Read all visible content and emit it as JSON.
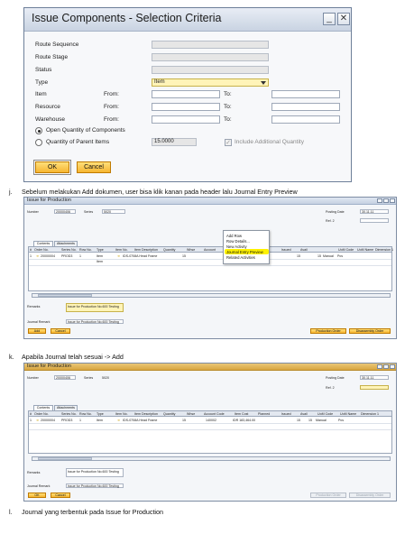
{
  "dialog": {
    "title": "Issue Components - Selection Criteria",
    "rows": [
      {
        "label": "Route Sequence",
        "value": ""
      },
      {
        "label": "Route Stage",
        "value": ""
      },
      {
        "label": "Status",
        "value": ""
      },
      {
        "label": "Type",
        "value": "Item"
      },
      {
        "label": "Item",
        "from": "From:",
        "to": "To:"
      },
      {
        "label": "Resource",
        "from": "From:",
        "to": "To:"
      },
      {
        "label": "Warehouse",
        "from": "From:",
        "to": "To:"
      }
    ],
    "radio_open": "Open Quantity of Components",
    "radio_parent": "Quantity of Parent Items",
    "parent_qty": "15.0000",
    "include_additional": "Include Additional Quantity",
    "ok": "OK",
    "cancel": "Cancel"
  },
  "captions": [
    {
      "num": "j.",
      "text": "Sebelum melakukan Add dokumen, user bisa klik kanan pada header lalu Journal Entry Preview"
    },
    {
      "num": "k.",
      "text": "Apabila Journal telah sesuai -> Add"
    },
    {
      "num": "l.",
      "text": "Journal yang terbentuk pada Issue for Production"
    }
  ],
  "win1": {
    "title": "Issue for Production",
    "number_label": "Number",
    "number": "20000406",
    "series_label": "Series",
    "series": "5020",
    "posting_label": "Posting Date",
    "posting": "30.11.11",
    "ref_label": "Ref. 2",
    "tabs": [
      "Contents",
      "Attachments"
    ],
    "headers": [
      "#",
      "Order No.",
      "Series No.",
      "Row No.",
      "Type",
      "Item No.",
      "Item Description",
      "Quantity",
      "Whse",
      "Account",
      "",
      "Issued",
      "Avail",
      "UoM Code",
      "UoM Name",
      "Dimension 1"
    ],
    "row1": [
      "1",
      "20000004",
      "PROD3",
      "1",
      "Item",
      "",
      "IDS-0708A Head Frame",
      "",
      "",
      "15",
      "",
      "",
      "15",
      "15",
      "Manual",
      "Pcs"
    ],
    "row2": [
      "Item"
    ],
    "context_menu": [
      "Add Row",
      "Row Details...",
      "New Activity",
      "Journal Entry Preview",
      "Related Activities"
    ],
    "remarks_label": "Remarks",
    "remarks": "Issue for Production No.600 Testing",
    "journal_label": "Journal Remark",
    "journal": "Issue for Production No.600 Testing",
    "btn_add": "Add",
    "btn_cancel": "Cancel",
    "btn_po": "Production Order",
    "btn_do": "Disassembly Order"
  },
  "win2": {
    "title": "Issue for Production",
    "number_label": "Number",
    "number": "20000406",
    "series_label": "Series",
    "series": "5020",
    "posting_label": "Posting Date",
    "posting": "30.11.11",
    "ref_label": "Ref. 2",
    "tabs": [
      "Contents",
      "Attachments"
    ],
    "headers": [
      "#",
      "Order No.",
      "Series No.",
      "Row No.",
      "Type",
      "Item No.",
      "Item Description",
      "Quantity",
      "Whse",
      "Account Code",
      "Item Cost",
      "Planned",
      "Issued",
      "Avail",
      "UoM Code",
      "UoM Name",
      "Dimension 1"
    ],
    "row1": [
      "1",
      "20000004",
      "PROD3",
      "1",
      "Item",
      "",
      "IDS-0708A Head Frame",
      "",
      "",
      "15",
      "",
      "",
      "140002",
      "IDR 183,464.00",
      "15",
      "15",
      "Manual",
      "Pcs"
    ],
    "remarks_label": "Remarks",
    "remarks": "Issue for Production No.600 Testing",
    "journal_label": "Journal Remark",
    "journal": "Issue for Production No.600 Testing",
    "btn_ok": "OK",
    "btn_cancel": "Cancel",
    "btn_po": "Production Order",
    "btn_do": "Disassembly Order"
  }
}
